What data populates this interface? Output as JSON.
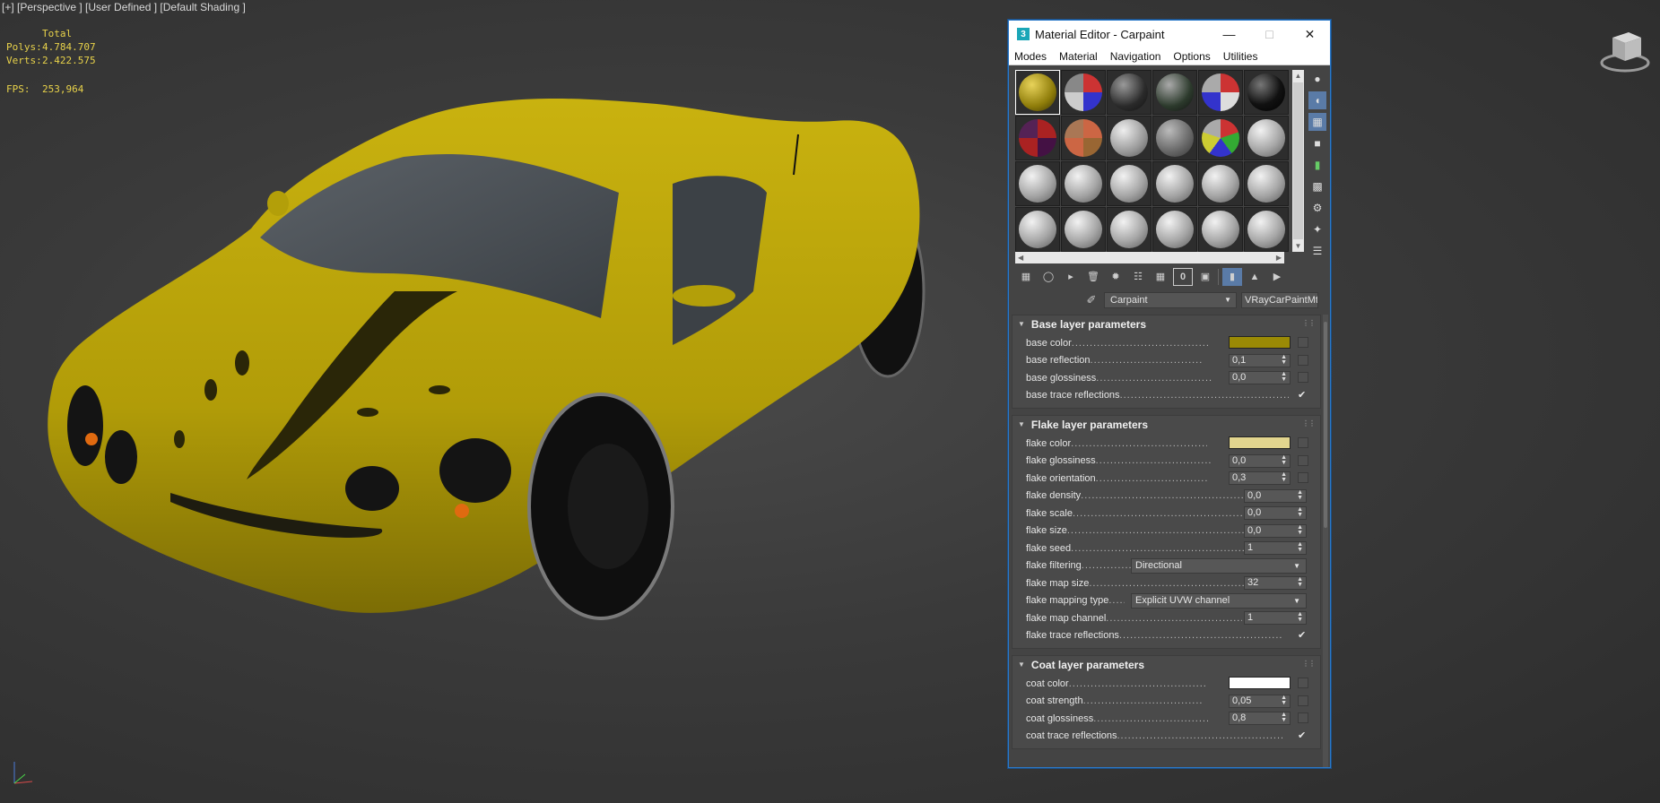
{
  "viewport": {
    "label": "[+] [Perspective ] [User Defined ] [Default Shading ]",
    "stats": {
      "header": "Total",
      "polys_label": "Polys:",
      "polys_value": "4.784.707",
      "verts_label": "Verts:",
      "verts_value": "2.422.575",
      "fps_label": "FPS:",
      "fps_value": "253,964"
    },
    "car_color": "#c8b40a"
  },
  "material_editor": {
    "title": "Material Editor - Carpaint",
    "app_icon": "3",
    "menu": [
      "Modes",
      "Material",
      "Navigation",
      "Options",
      "Utilities"
    ],
    "material_name": "Carpaint",
    "material_type": "VRayCarPaintMtl",
    "slots": [
      {
        "kind": "gold"
      },
      {
        "kind": "checker-blue"
      },
      {
        "kind": "dark-metal"
      },
      {
        "kind": "dark-checker"
      },
      {
        "kind": "checker-red"
      },
      {
        "kind": "black"
      },
      {
        "kind": "checker-red2"
      },
      {
        "kind": "checker-orange"
      },
      {
        "kind": "logo"
      },
      {
        "kind": "gray-metal"
      },
      {
        "kind": "checker-multi"
      },
      {
        "kind": "gray"
      },
      {
        "kind": "gray"
      },
      {
        "kind": "gray"
      },
      {
        "kind": "gray"
      },
      {
        "kind": "gray"
      },
      {
        "kind": "gray"
      },
      {
        "kind": "gray"
      },
      {
        "kind": "gray"
      },
      {
        "kind": "gray"
      },
      {
        "kind": "gray"
      },
      {
        "kind": "gray"
      },
      {
        "kind": "gray"
      },
      {
        "kind": "gray"
      }
    ],
    "rollouts": {
      "base": {
        "title": "Base layer parameters",
        "params": {
          "color_label": "base color",
          "color_value": "#9a8a05",
          "reflection_label": "base reflection",
          "reflection_value": "0,1",
          "glossiness_label": "base glossiness",
          "glossiness_value": "0,0",
          "trace_label": "base trace reflections",
          "trace_check": "✔"
        }
      },
      "flake": {
        "title": "Flake layer parameters",
        "params": {
          "color_label": "flake color",
          "color_value": "#e2d58e",
          "glossiness_label": "flake glossiness",
          "glossiness_value": "0,0",
          "orientation_label": "flake orientation",
          "orientation_value": "0,3",
          "density_label": "flake density",
          "density_value": "0,0",
          "scale_label": "flake scale",
          "scale_value": "0,0",
          "size_label": "flake size",
          "size_value": "0,0",
          "seed_label": "flake seed",
          "seed_value": "1",
          "filtering_label": "flake filtering",
          "filtering_value": "Directional",
          "map_size_label": "flake map size",
          "map_size_value": "32",
          "mapping_type_label": "flake mapping type",
          "mapping_type_value": "Explicit UVW channel",
          "map_channel_label": "flake map channel",
          "map_channel_value": "1",
          "trace_label": "flake trace reflections",
          "trace_check": "✔"
        }
      },
      "coat": {
        "title": "Coat layer parameters",
        "params": {
          "color_label": "coat color",
          "color_value": "#ffffff",
          "strength_label": "coat strength",
          "strength_value": "0,05",
          "glossiness_label": "coat glossiness",
          "glossiness_value": "0,8",
          "trace_label": "coat trace reflections",
          "trace_check": "✔"
        }
      }
    }
  }
}
